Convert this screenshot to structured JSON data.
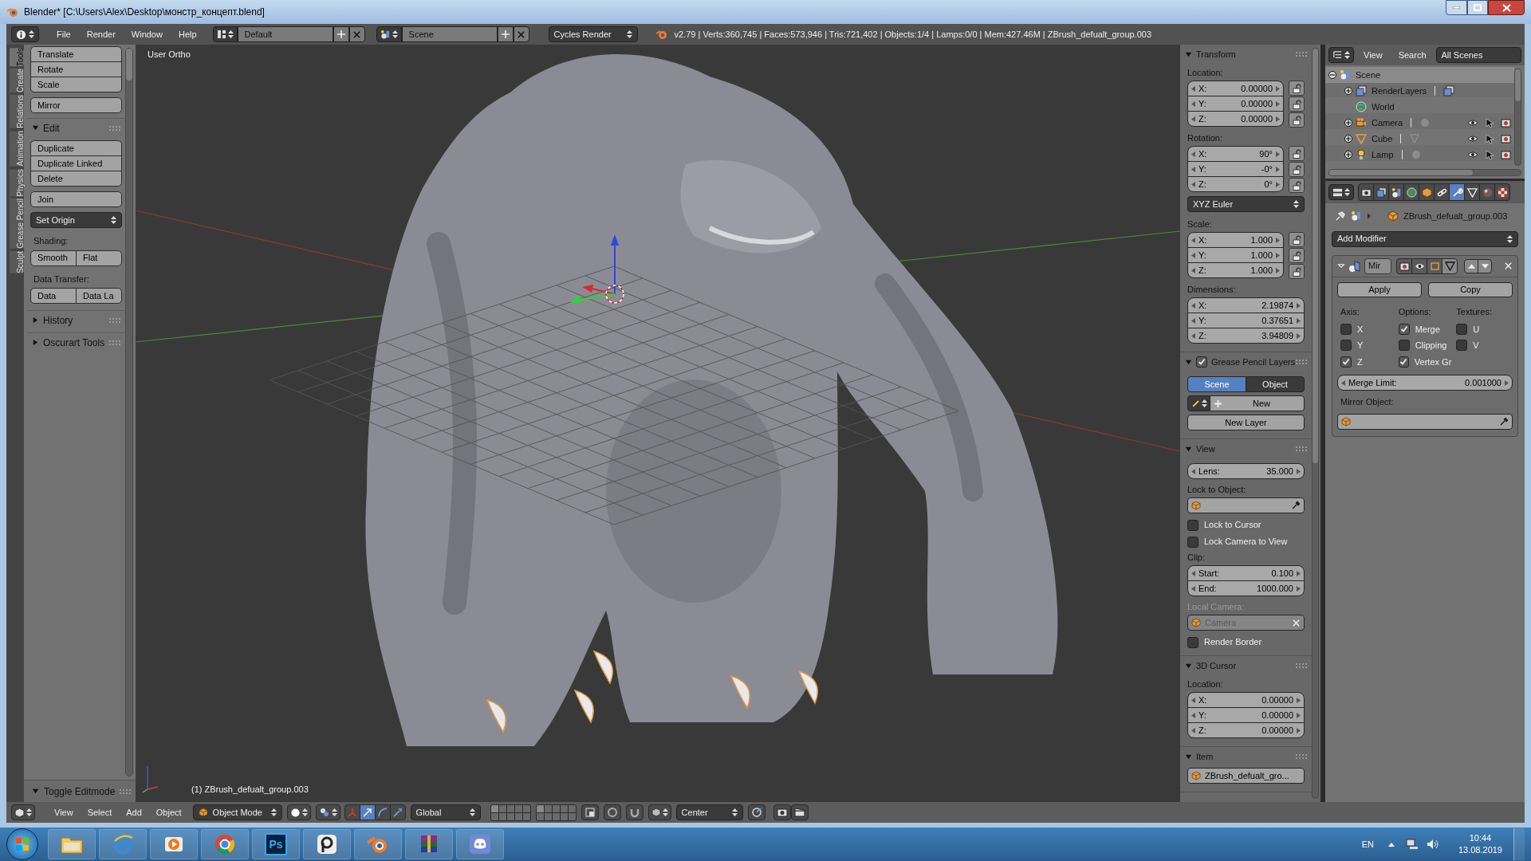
{
  "window": {
    "title": "Blender* [C:\\Users\\Alex\\Desktop\\монстр_концепт.blend]"
  },
  "info_header": {
    "menus": [
      "File",
      "Render",
      "Window",
      "Help"
    ],
    "screen_layout": "Default",
    "scene": "Scene",
    "render_engine": "Cycles Render",
    "stats": "v2.79 | Verts:360,745 | Faces:573,946 | Tris:721,402 | Objects:1/4 | Lamps:0/0 | Mem:427.46M | ZBrush_defualt_group.003"
  },
  "tool_shelf": {
    "tabs": [
      {
        "label": "Tools",
        "selected": true
      },
      {
        "label": "Create",
        "selected": false
      },
      {
        "label": "Relations",
        "selected": false
      },
      {
        "label": "Animation",
        "selected": false
      },
      {
        "label": "Physics",
        "selected": false
      },
      {
        "label": "Grease Pencil",
        "selected": false
      },
      {
        "label": "Sculpt",
        "selected": false
      }
    ],
    "items": [
      {
        "kind": "stack",
        "buttons": [
          "Translate",
          "Rotate",
          "Scale"
        ]
      },
      {
        "kind": "stack",
        "buttons": [
          "Mirror"
        ]
      },
      {
        "kind": "panel",
        "label": "Edit",
        "expanded": true
      },
      {
        "kind": "stack",
        "buttons": [
          "Duplicate",
          "Duplicate Linked",
          "Delete"
        ]
      },
      {
        "kind": "stack",
        "buttons": [
          "Join"
        ]
      },
      {
        "kind": "dropdown",
        "label": "Set Origin"
      },
      {
        "kind": "label",
        "label": "Shading:"
      },
      {
        "kind": "row",
        "buttons": [
          "Smooth",
          "Flat"
        ]
      },
      {
        "kind": "label",
        "label": "Data Transfer:"
      },
      {
        "kind": "row",
        "buttons": [
          "Data",
          "Data La"
        ]
      },
      {
        "kind": "panel",
        "label": "History",
        "expanded": false
      },
      {
        "kind": "panel",
        "label": "Oscurart Tools",
        "expanded": false
      }
    ],
    "operator_panel": {
      "title": "Toggle Editmode",
      "expanded": true
    }
  },
  "viewport": {
    "view_name": "User Ortho",
    "object_info": "(1) ZBrush_defualt_group.003"
  },
  "properties_region": {
    "sections": [
      {
        "title": "Transform",
        "expanded": true,
        "rows": [
          {
            "kind": "label",
            "text": "Location:",
            "disabled": false
          },
          {
            "kind": "vector",
            "fields": [
              {
                "label": "X:",
                "value": "0.00000",
                "locked": false
              },
              {
                "label": "Y:",
                "value": "0.00000",
                "locked": false
              },
              {
                "label": "Z:",
                "value": "0.00000",
                "locked": false
              }
            ]
          },
          {
            "kind": "label",
            "text": "Rotation:",
            "disabled": false
          },
          {
            "kind": "vector",
            "fields": [
              {
                "label": "X:",
                "value": "90°",
                "locked": false
              },
              {
                "label": "Y:",
                "value": "-0°",
                "locked": false
              },
              {
                "label": "Z:",
                "value": "0°",
                "locked": false
              }
            ]
          },
          {
            "kind": "dropdown",
            "text": "XYZ Euler"
          },
          {
            "kind": "label",
            "text": "Scale:",
            "disabled": false
          },
          {
            "kind": "vector",
            "fields": [
              {
                "label": "X:",
                "value": "1.000",
                "locked": false
              },
              {
                "label": "Y:",
                "value": "1.000",
                "locked": false
              },
              {
                "label": "Z:",
                "value": "1.000",
                "locked": false
              }
            ]
          },
          {
            "kind": "label",
            "text": "Dimensions:",
            "disabled": false
          },
          {
            "kind": "vector",
            "fields": [
              {
                "label": "X:",
                "value": "2.19874"
              },
              {
                "label": "Y:",
                "value": "0.37651"
              },
              {
                "label": "Z:",
                "value": "3.94809"
              }
            ]
          }
        ]
      },
      {
        "title": "Grease Pencil Layers",
        "expanded": true,
        "checked": true,
        "rows": [
          {
            "kind": "toggle",
            "options": [
              {
                "label": "Scene",
                "selected": true
              },
              {
                "label": "Object",
                "selected": false
              }
            ]
          },
          {
            "kind": "new_row",
            "text": "New"
          },
          {
            "kind": "button",
            "text": "New Layer"
          }
        ]
      },
      {
        "title": "View",
        "expanded": true,
        "rows": [
          {
            "kind": "number",
            "label": "Lens:",
            "value": "35.000"
          },
          {
            "kind": "label",
            "text": "Lock to Object:",
            "disabled": false
          },
          {
            "kind": "object_field",
            "disabled": false
          },
          {
            "kind": "checkbox",
            "text": "Lock to Cursor",
            "checked": false
          },
          {
            "kind": "checkbox",
            "text": "Lock Camera to View",
            "checked": false
          },
          {
            "kind": "label",
            "text": "Clip:",
            "disabled": false
          },
          {
            "kind": "vector",
            "fields": [
              {
                "label": "Start:",
                "value": "0.100"
              },
              {
                "label": "End:",
                "value": "1000.000"
              }
            ]
          },
          {
            "kind": "label",
            "text": "Local Camera:",
            "disabled": true
          },
          {
            "kind": "object_field",
            "value": "Camera",
            "disabled": true
          },
          {
            "kind": "checkbox",
            "text": "Render Border",
            "checked": false
          }
        ]
      },
      {
        "title": "3D Cursor",
        "expanded": true,
        "rows": [
          {
            "kind": "label",
            "text": "Location:",
            "disabled": false
          },
          {
            "kind": "vector",
            "fields": [
              {
                "label": "X:",
                "value": "0.00000"
              },
              {
                "label": "Y:",
                "value": "0.00000"
              },
              {
                "label": "Z:",
                "value": "0.00000"
              }
            ]
          }
        ]
      },
      {
        "title": "Item",
        "expanded": true,
        "rows": [
          {
            "kind": "object_field",
            "value": "ZBrush_defualt_gro...",
            "disabled": false
          }
        ]
      }
    ]
  },
  "outliner": {
    "menus": [
      "View",
      "Search"
    ],
    "display_mode": "All Scenes",
    "tree": [
      {
        "kind": "scene",
        "label": "Scene",
        "expanded": true,
        "selected": true,
        "children": [
          {
            "kind": "renderlayers",
            "label": "RenderLayers",
            "expanded": false,
            "selected": false
          },
          {
            "kind": "world",
            "label": "World",
            "selected": false
          },
          {
            "kind": "camera",
            "label": "Camera",
            "expanded": false,
            "selected": false
          },
          {
            "kind": "mesh",
            "label": "Cube",
            "expanded": false,
            "selected": false
          },
          {
            "kind": "lamp",
            "label": "Lamp",
            "expanded": false,
            "selected": false
          }
        ]
      }
    ]
  },
  "properties_editor": {
    "tabs": [
      {
        "kind": "render",
        "selected": false
      },
      {
        "kind": "renderlayers",
        "selected": false
      },
      {
        "kind": "scene",
        "selected": false
      },
      {
        "kind": "world",
        "selected": false
      },
      {
        "kind": "object",
        "selected": false
      },
      {
        "kind": "constraints",
        "selected": false
      },
      {
        "kind": "modifiers",
        "selected": true
      },
      {
        "kind": "data",
        "selected": false
      },
      {
        "kind": "material",
        "selected": false
      },
      {
        "kind": "texture",
        "selected": false
      }
    ],
    "context_path": "ZBrush_defualt_group.003",
    "add_modifier": "Add Modifier",
    "modifier": {
      "name": "Mir",
      "expanded": true,
      "buttons": [
        "Apply",
        "Copy"
      ],
      "columns": [
        {
          "title": "Axis:",
          "options": [
            {
              "label": "X",
              "checked": false
            },
            {
              "label": "Y",
              "checked": false
            },
            {
              "label": "Z",
              "checked": true
            }
          ]
        },
        {
          "title": "Options:",
          "options": [
            {
              "label": "Merge",
              "checked": true
            },
            {
              "label": "Clipping",
              "checked": false
            },
            {
              "label": "Vertex Gr",
              "checked": true
            }
          ]
        },
        {
          "title": "Textures:",
          "options": [
            {
              "label": "U",
              "checked": false
            },
            {
              "label": "V",
              "checked": false
            }
          ]
        }
      ],
      "merge_limit": {
        "label": "Merge Limit:",
        "value": "0.001000"
      },
      "mirror_object_label": "Mirror Object:"
    }
  },
  "view3d_header": {
    "menus": [
      "View",
      "Select",
      "Add",
      "Object"
    ],
    "mode": "Object Mode",
    "orientation": "Global",
    "pivot": "Center"
  },
  "taskbar": {
    "apps": [
      {
        "kind": "folder"
      },
      {
        "kind": "browser"
      },
      {
        "kind": "media"
      },
      {
        "kind": "chrome"
      },
      {
        "kind": "photoshop",
        "label": "Ps"
      },
      {
        "kind": "viewer"
      },
      {
        "kind": "blender"
      },
      {
        "kind": "archiver"
      },
      {
        "kind": "chat"
      }
    ],
    "language": "EN",
    "time": "10:44",
    "date": "13.08.2019"
  }
}
